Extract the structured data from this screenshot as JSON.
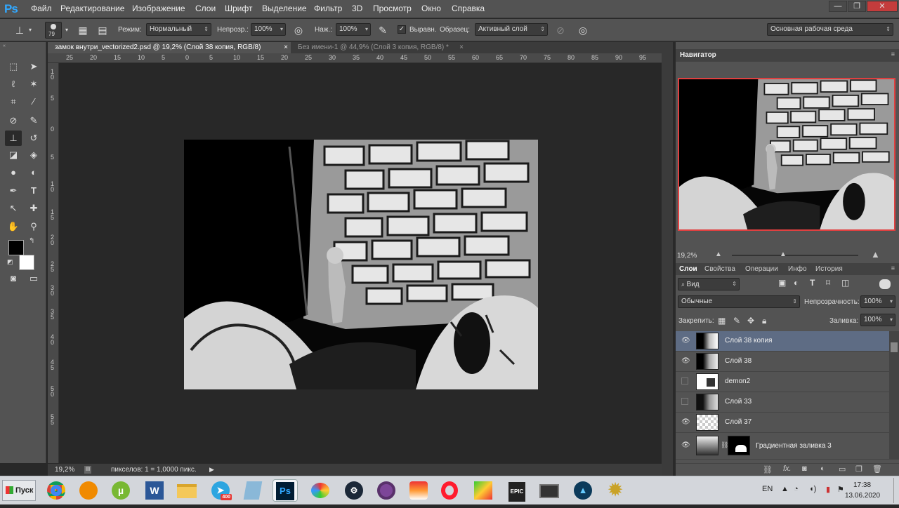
{
  "app": {
    "logo": "Ps"
  },
  "menu": [
    "Файл",
    "Редактирование",
    "Изображение",
    "Слои",
    "Шрифт",
    "Выделение",
    "Фильтр",
    "3D",
    "Просмотр",
    "Окно",
    "Справка"
  ],
  "window_controls": {
    "minimize": "—",
    "restore": "❐",
    "close": "✕"
  },
  "options": {
    "brush_size": "79",
    "mode_label": "Режим:",
    "mode_value": "Нормальный",
    "opacity_label": "Непрозр.:",
    "opacity_value": "100%",
    "pressure_label": "Наж.:",
    "pressure_value": "100%",
    "aligned_label": "Выравн.",
    "sample_label": "Образец:",
    "sample_value": "Активный слой",
    "workspace": "Основная рабочая среда"
  },
  "tabs": [
    {
      "label": "замок внутри_vectorized2.psd @ 19,2% (Слой 38 копия, RGB/8)",
      "close": "×"
    },
    {
      "label": "Без имени-1 @ 44,9% (Слой 3 копия, RGB/8) *",
      "close": "×"
    }
  ],
  "ruler_h": [
    "25",
    "20",
    "15",
    "10",
    "5",
    "0",
    "5",
    "10",
    "15",
    "20",
    "25",
    "30",
    "35",
    "40",
    "45",
    "50",
    "55",
    "60",
    "65",
    "70",
    "75",
    "80",
    "85",
    "90",
    "95"
  ],
  "ruler_v": [
    "1 0",
    "5",
    "0",
    "5",
    "1 0",
    "1 5",
    "2 0",
    "2 5",
    "3 0",
    "3 5",
    "4 0",
    "4 5",
    "5 0",
    "5 5"
  ],
  "status": {
    "zoom": "19,2%",
    "info": "пикселов: 1 = 1,0000 пикс."
  },
  "navigator": {
    "title": "Навигатор",
    "zoom": "19,2%"
  },
  "layers_panel": {
    "tabs": [
      "Слои",
      "Свойства",
      "Операции",
      "Инфо",
      "История"
    ],
    "filter": "Вид",
    "blend": "Обычные",
    "opacity_label": "Непрозрачность:",
    "opacity_value": "100%",
    "lock_label": "Закрепить:",
    "fill_label": "Заливка:",
    "fill_value": "100%",
    "layers": [
      {
        "name": "Слой 38 копия",
        "visible": true,
        "selected": true
      },
      {
        "name": "Слой 38",
        "visible": true,
        "selected": false
      },
      {
        "name": "demon2",
        "visible": false,
        "selected": false
      },
      {
        "name": "Слой 33",
        "visible": false,
        "selected": false
      },
      {
        "name": "Слой 37",
        "visible": true,
        "selected": false
      },
      {
        "name": "Градиентная заливка 3",
        "visible": true,
        "selected": false
      }
    ],
    "footer_icons": [
      "link-icon",
      "fx-icon",
      "mask-icon",
      "adjustment-icon",
      "group-icon",
      "new-layer-icon",
      "trash-icon"
    ]
  },
  "taskbar": {
    "start": "Пуск",
    "apps": [
      "chrome",
      "avast",
      "utorrent",
      "word",
      "explorer",
      "telegram",
      "notepad",
      "photoshop",
      "paint",
      "steam",
      "tor",
      "yandex",
      "opera",
      "spotify",
      "epic",
      "monitor",
      "arcade",
      "settings"
    ],
    "telegram_badge": "400",
    "ps_label": "Ps",
    "epic_label": "EPIC",
    "word_label": "W",
    "lang": "EN",
    "time": "17:38",
    "date": "13.06.2020"
  }
}
